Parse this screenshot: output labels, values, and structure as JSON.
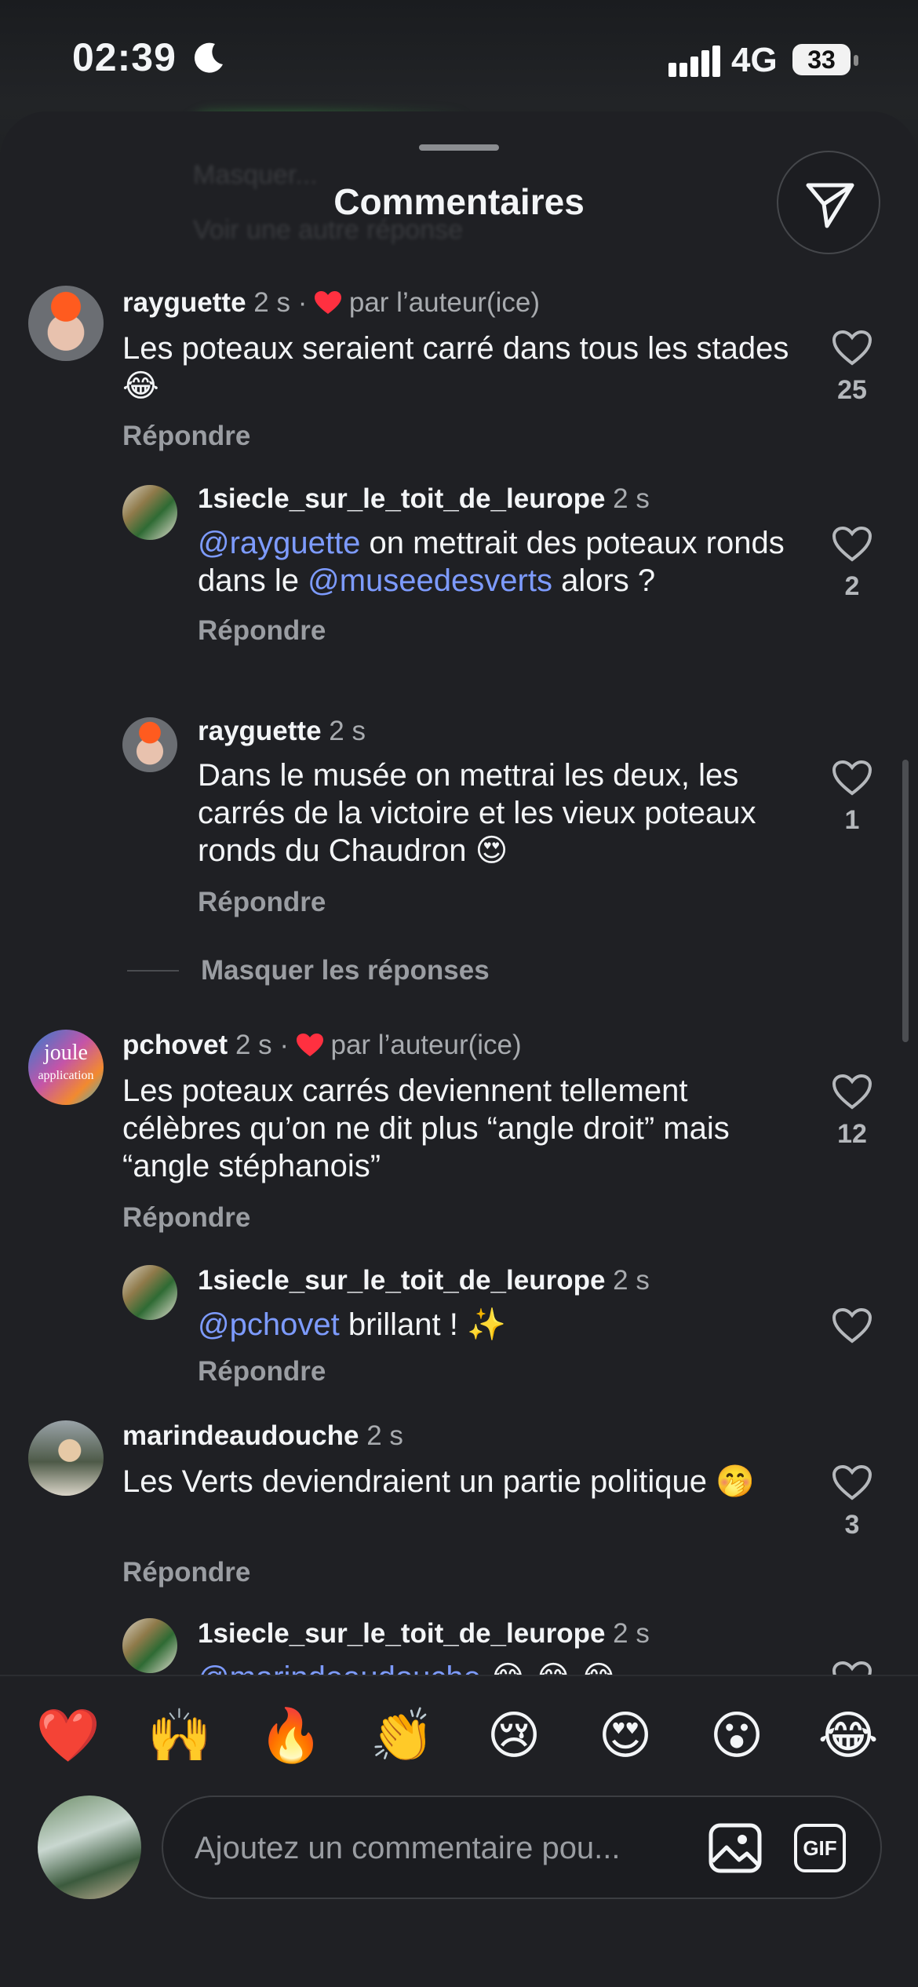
{
  "status_bar": {
    "time": "02:39",
    "network": "4G",
    "battery": "33"
  },
  "sheet": {
    "title": "Commentaires",
    "ghost_line1": "Masquer...",
    "ghost_line2": "Voir une autre réponse"
  },
  "comments": [
    {
      "username": "rayguette",
      "time": "2 s",
      "separator": "·",
      "author_like": "par l’auteur(ice)",
      "text": "Les poteaux seraient carré dans tous les stades😂",
      "reply": "Répondre",
      "likes": "25"
    },
    {
      "username": "1siecle_sur_le_toit_de_leurope",
      "time": "2 s",
      "mention1": "@rayguette",
      "text_part1": " on mettrait des poteaux ronds dans le ",
      "mention2": "@museedesverts",
      "text_part2": " alors ?",
      "reply": "Répondre",
      "likes": "2"
    },
    {
      "username": "rayguette",
      "time": "2 s",
      "text": "Dans le musée on mettrai les deux, les carrés de la victoire et les vieux poteaux ronds du Chaudron 😍",
      "reply": "Répondre",
      "likes": "1"
    },
    {
      "username": "pchovet",
      "time": "2 s",
      "separator": "·",
      "author_like": "par l’auteur(ice)",
      "text": "Les poteaux carrés deviennent tellement célèbres qu’on ne dit plus “angle droit” mais “angle stéphanois”",
      "reply": "Répondre",
      "likes": "12"
    },
    {
      "username": "1siecle_sur_le_toit_de_leurope",
      "time": "2 s",
      "mention1": "@pchovet",
      "text_part1": " brillant ! ✨",
      "reply": "Répondre"
    },
    {
      "username": "marindeaudouche",
      "time": "2 s",
      "text": "Les Verts deviendraient un partie politique 🤭",
      "reply": "Répondre",
      "likes": "3"
    },
    {
      "username": "1siecle_sur_le_toit_de_leurope",
      "time": "2 s",
      "mention1": "@marindeaudouche",
      "text_part1": " 😂 😂 😂"
    }
  ],
  "hide_replies": "Masquer les réponses",
  "avatar_texts": {
    "pchovet_line1": "joule",
    "pchovet_line2": "application"
  },
  "emoji_bar": [
    "❤️",
    "🙌",
    "🔥",
    "👏",
    "😢",
    "😍",
    "😮",
    "😂"
  ],
  "composer": {
    "placeholder": "Ajoutez un commentaire pou...",
    "gif_label": "GIF"
  },
  "colors": {
    "mention": "#7d9bff",
    "heart": "#ff3040",
    "background": "#1f2024"
  }
}
